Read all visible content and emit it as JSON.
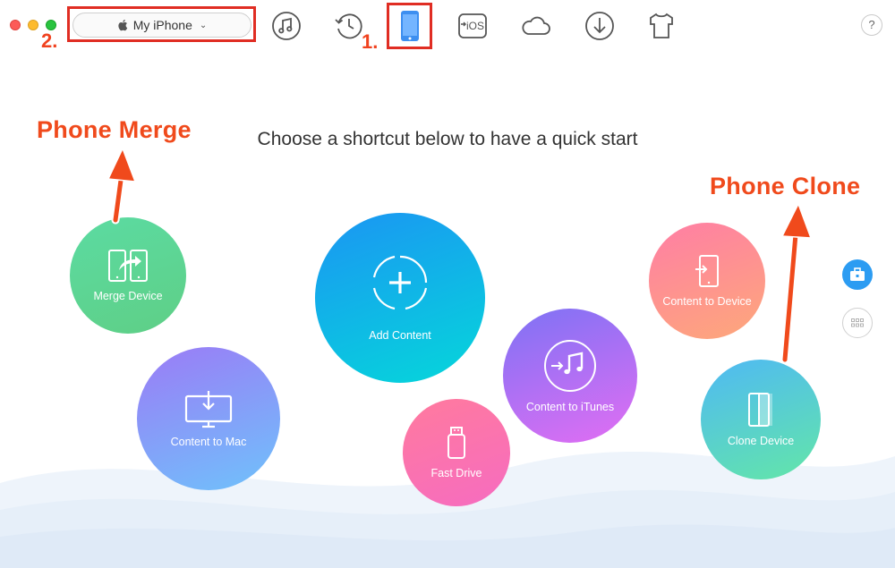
{
  "device_selector": {
    "label": "My iPhone",
    "icon": "apple-icon",
    "chevron": "⌄"
  },
  "step_markers": {
    "step1": "1.",
    "step2": "2."
  },
  "toolbar": {
    "icons": [
      "music-icon",
      "history-icon",
      "phone-icon",
      "to-ios-icon",
      "cloud-icon",
      "download-icon",
      "tshirt-icon"
    ],
    "to_ios_text": "iOS",
    "help": "?"
  },
  "main": {
    "headline": "Choose a shortcut below to have a quick start",
    "shortcuts": {
      "merge_device": "Merge Device",
      "content_to_mac": "Content to Mac",
      "add_content": "Add Content",
      "fast_drive": "Fast Drive",
      "content_to_itunes": "Content to iTunes",
      "content_to_device": "Content to Device",
      "clone_device": "Clone Device"
    }
  },
  "annotations": {
    "merge": "Phone Merge",
    "clone": "Phone Clone"
  },
  "colors": {
    "accent": "#2c9cf2",
    "annotation": "#f04a1c",
    "highlight_box": "#e02d23"
  }
}
